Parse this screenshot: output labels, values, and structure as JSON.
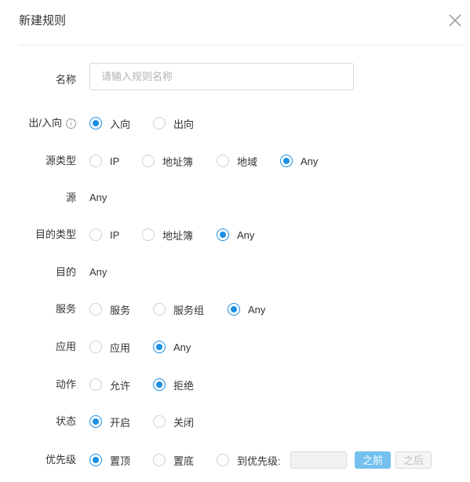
{
  "dialog": {
    "title": "新建规则"
  },
  "name": {
    "label": "名称",
    "placeholder": "请输入规则名称",
    "value": ""
  },
  "direction": {
    "label": "出/入向",
    "info_icon": "info-icon",
    "options": [
      "入向",
      "出向"
    ],
    "selected": "入向"
  },
  "source_type": {
    "label": "源类型",
    "options": [
      "IP",
      "地址簿",
      "地域",
      "Any"
    ],
    "selected": "Any"
  },
  "source": {
    "label": "源",
    "value": "Any"
  },
  "dest_type": {
    "label": "目的类型",
    "options": [
      "IP",
      "地址簿",
      "Any"
    ],
    "selected": "Any"
  },
  "dest": {
    "label": "目的",
    "value": "Any"
  },
  "service": {
    "label": "服务",
    "options": [
      "服务",
      "服务组",
      "Any"
    ],
    "selected": "Any"
  },
  "application": {
    "label": "应用",
    "options": [
      "应用",
      "Any"
    ],
    "selected": "Any"
  },
  "action": {
    "label": "动作",
    "options": [
      "允许",
      "拒绝"
    ],
    "selected": "拒绝"
  },
  "status": {
    "label": "状态",
    "options": [
      "开启",
      "关闭"
    ],
    "selected": "开启"
  },
  "priority": {
    "label": "优先级",
    "options": [
      "置顶",
      "置底",
      "到优先级:"
    ],
    "selected": "置顶",
    "before_button": "之前",
    "after_button": "之后"
  },
  "colors": {
    "accent": "#1a8fe3",
    "button_primary": "#74c0ee"
  }
}
